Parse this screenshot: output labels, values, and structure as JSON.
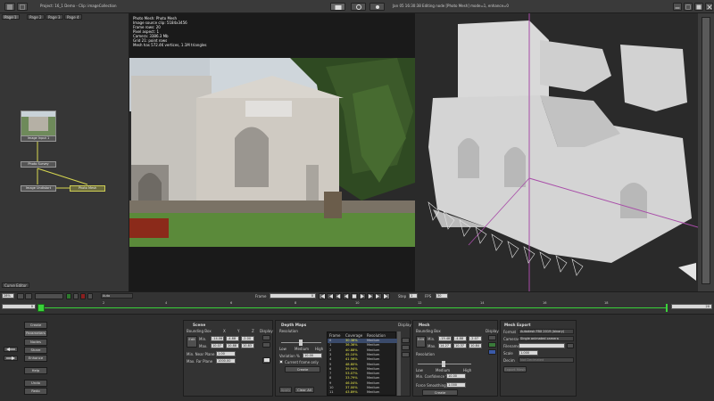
{
  "topbar": {
    "project_title": "Project: 16_1 Demo - Clip: imageCollection",
    "status_text": "Jan 05 16:30:38 Editing node [Photo Mesh] mode=1, enhance=0"
  },
  "node_editor": {
    "pages": [
      "Page 1",
      "Page 2",
      "Page 3",
      "Page 4"
    ],
    "nodes": {
      "image_input": "Image Input 1",
      "photo_survey": "Photo Survey",
      "image_undistort": "Image Undistort",
      "photo_mesh": "Photo Mesh"
    },
    "curve_editor_label": "Curve Editor"
  },
  "viewer": {
    "overlay_lines": [
      "Photo Mesh: Photo Mesh",
      "Image source clip: 5184x3456",
      "Frame rows: 20",
      "Pixel aspect: 1",
      "Camera: 3386.3 Mb",
      "Grid 21: point rows",
      "Mesh has 572.4K vertices, 1.1M triangles"
    ],
    "zoom": "28%",
    "display_mode": "Auto"
  },
  "timeline": {
    "frame_label": "Frame",
    "frame_value": "0",
    "step_label": "Step",
    "step_value": "1",
    "fps_label": "FPS",
    "fps_value": "30",
    "start": "0",
    "end": "20",
    "ticks": [
      "2",
      "4",
      "6",
      "8",
      "10",
      "12",
      "14",
      "16",
      "18"
    ]
  },
  "sidebar_buttons": [
    "Create",
    "Parameters",
    "Nodes",
    "Share",
    "Enhance",
    "Help",
    "Undo",
    "Redo"
  ],
  "scene": {
    "title": "Scene",
    "bounding_box": "Bounding Box",
    "x": "X",
    "y": "Y",
    "z": "Z",
    "min_label": "Min.",
    "max_label": "Max.",
    "min": [
      "-14.06",
      "-4.88",
      "-2.00"
    ],
    "max": [
      "10.07",
      "10.88",
      "10.83"
    ],
    "edit": "Edit",
    "display": "Display",
    "near_label": "Min. Near Plane",
    "near_value": "1.00",
    "far_label": "Max. Far Plane",
    "far_value": "1000.00"
  },
  "depth_maps": {
    "title": "Depth Maps",
    "resolution": "Resolution",
    "low": "Low",
    "medium": "Medium",
    "high": "High",
    "variation_label": "Variation %",
    "variation_value": "10.00",
    "current_frame_only": "Current frame only",
    "create": "Create",
    "table_headers": [
      "Frame",
      "Coverage",
      "Resolution"
    ],
    "table_rows": [
      [
        "0",
        "30.38%",
        "Medium"
      ],
      [
        "1",
        "36.36%",
        "Medium"
      ],
      [
        "2",
        "40.88%",
        "Medium"
      ],
      [
        "3",
        "45.10%",
        "Medium"
      ],
      [
        "4",
        "41.56%",
        "Medium"
      ],
      [
        "5",
        "48.80%",
        "Medium"
      ],
      [
        "6",
        "39.94%",
        "Medium"
      ],
      [
        "7",
        "53.07%",
        "Medium"
      ],
      [
        "8",
        "33.79%",
        "Medium"
      ],
      [
        "9",
        "46.04%",
        "Medium"
      ],
      [
        "10",
        "37.00%",
        "Medium"
      ],
      [
        "11",
        "43.89%",
        "Medium"
      ]
    ],
    "clear_all": "Clear All",
    "apply": "Apply",
    "display": "Display"
  },
  "mesh": {
    "title": "Mesh",
    "bounding_box": "Bounding Box",
    "min_label": "Min.",
    "max_label": "Max.",
    "min": [
      "-15.48",
      "-4.88",
      "-2.07"
    ],
    "max": [
      "14.27",
      "10.37",
      "10.84"
    ],
    "edit": "Edit",
    "display": "Display",
    "resolution": "Resolution",
    "low": "Low",
    "medium": "Medium",
    "high": "High",
    "confidence_label": "Min. Confidence %",
    "confidence_value": "10.00",
    "smoothing_label": "Force Smoothing %",
    "smoothing_value": "1.000",
    "create": "Create"
  },
  "mesh_export": {
    "title": "Mesh Export",
    "format_label": "Format",
    "format_value": "Autodesk FBX 2019 (binary)",
    "cameras_label": "Cameras",
    "cameras_value": "Single animated camera",
    "filename_label": "Filename",
    "filename_value": "",
    "scale_label": "Scale",
    "scale_value": "1.000",
    "decim_label": "Decim",
    "decim_value": "Not Decimated",
    "export": "Export Mesh"
  }
}
